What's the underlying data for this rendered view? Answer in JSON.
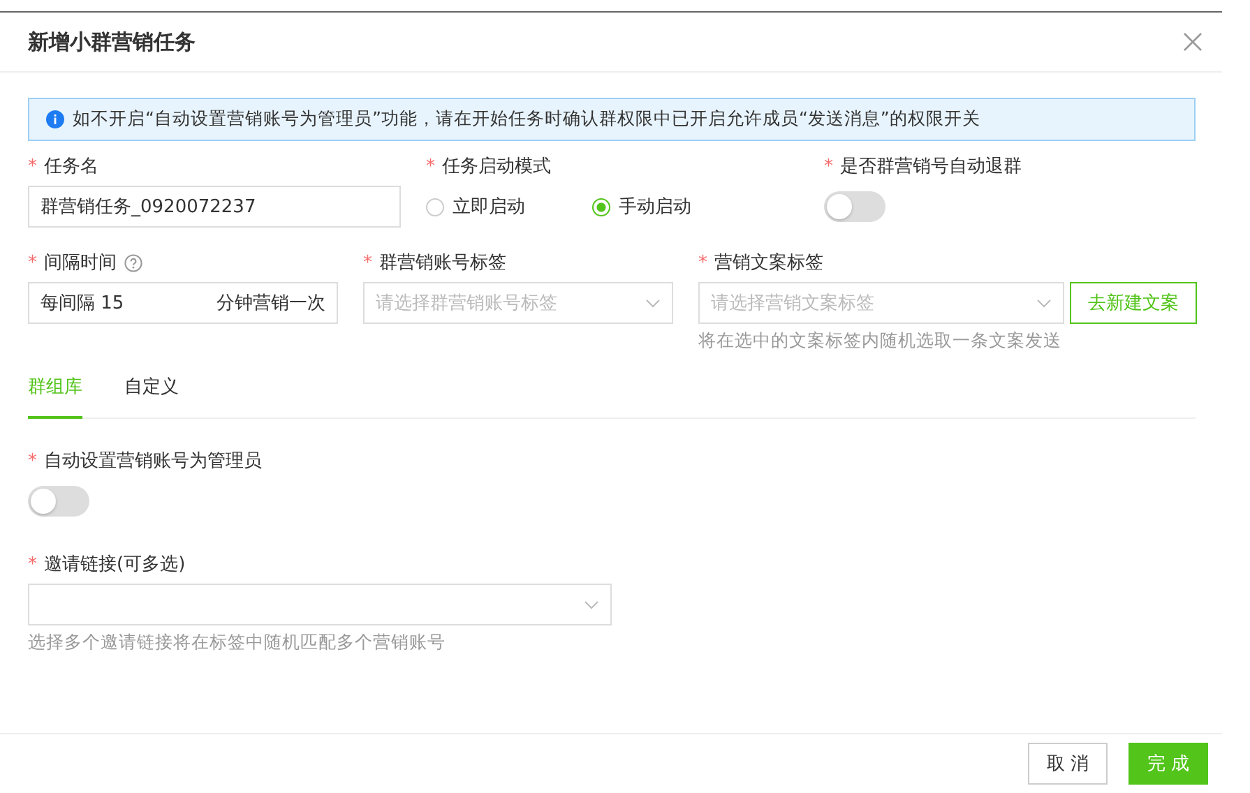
{
  "dialog": {
    "title": "新增小群营销任务"
  },
  "notice": "如不开启“自动设置营销账号为管理员”功能，请在开始任务时确认群权限中已开启允许成员“发送消息”的权限开关",
  "row1": [
    {
      "kind": "text",
      "label": "任务名",
      "mark": "*",
      "value": "群营销任务_0920072237"
    },
    {
      "kind": "radio",
      "label": "任务启动模式",
      "mark": "*",
      "options": [
        {
          "label": "立即启动",
          "selected": false
        },
        {
          "label": "手动启动",
          "selected": true
        }
      ]
    },
    {
      "kind": "switch",
      "label": "是否群营销号自动退群",
      "mark": "*",
      "on": false
    }
  ],
  "row2": [
    {
      "kind": "interval",
      "label": "间隔时间",
      "mark": "*",
      "help": true,
      "prefix": "每间隔",
      "value": "15",
      "suffix": "分钟营销一次"
    },
    {
      "kind": "select",
      "label": "群营销账号标签",
      "mark": "*",
      "placeholder": "请选择群营销账号标签"
    },
    {
      "kind": "select",
      "label": "营销文案标签",
      "mark": "*",
      "placeholder": "请选择营销文案标签",
      "button": "去新建文案",
      "hint": "将在选中的文案标签内随机选取一条文案发送"
    }
  ],
  "tabs": [
    {
      "label": "群组库",
      "selected": true
    },
    {
      "label": "自定义",
      "selected": false
    }
  ],
  "tab_fields": [
    {
      "kind": "switch",
      "label": "自动设置营销账号为管理员",
      "mark": "*",
      "on": false
    },
    {
      "kind": "select",
      "label": "邀请链接(可多选)",
      "mark": "*",
      "hint": "选择多个邀请链接将在标签中随机匹配多个营销账号"
    }
  ],
  "buttons": [
    {
      "label": "取 消",
      "kind": "default"
    },
    {
      "label": "完 成",
      "kind": "primary"
    }
  ]
}
